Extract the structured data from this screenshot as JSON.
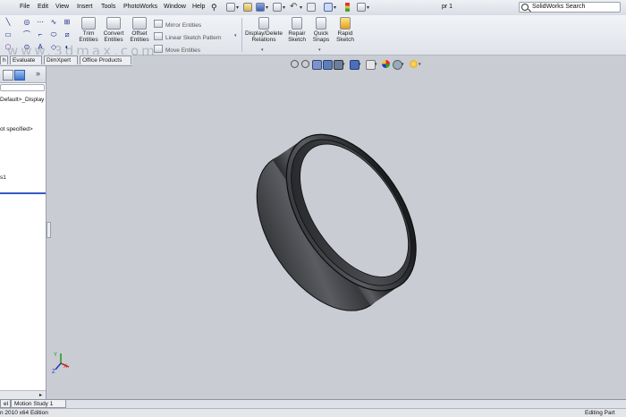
{
  "menu": {
    "items": [
      "File",
      "Edit",
      "View",
      "Insert",
      "Tools",
      "PhotoWorks",
      "Window",
      "Help"
    ],
    "document_title": "pr 1",
    "search_placeholder": "SolidWorks Search"
  },
  "command_manager": {
    "trim": "Trim Entities",
    "convert": "Convert Entities",
    "offset": "Offset Entities",
    "mirror": "Mirror Entities",
    "linear_pattern": "Linear Sketch Pattern",
    "move": "Move Entities",
    "display_delete": "Display/Delete Relations",
    "repair": "Repair Sketch",
    "quick_snaps": "Quick Snaps",
    "rapid": "Rapid Sketch"
  },
  "tabs": [
    "h",
    "Evaluate",
    "DimXpert",
    "Office Products"
  ],
  "feature_tree": {
    "line1": "Default>_Display",
    "line2": "ot specified>",
    "line3": "s1"
  },
  "bottom_tabs": [
    "el",
    "Motion Study 1"
  ],
  "status": {
    "left": "n 2010 x64 Edition",
    "right": "Editing Part"
  },
  "watermark": "www.3dmax.com",
  "triad_labels": {
    "x": "X",
    "y": "Y",
    "z": "Z"
  }
}
